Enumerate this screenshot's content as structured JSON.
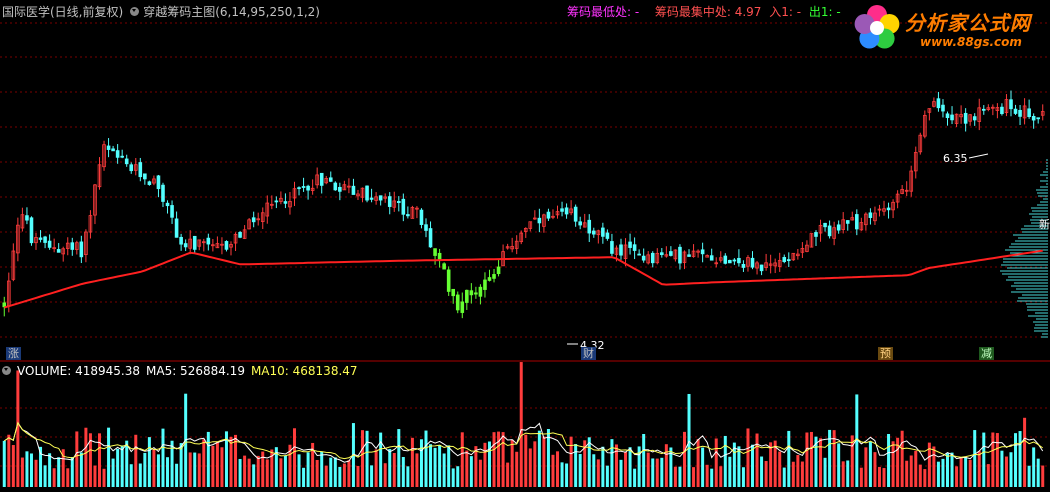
{
  "header": {
    "stock_name": "国际医学(日线,前复权)",
    "indicator_title": "穿越筹码主图(6,14,95,250,1,2)",
    "chip_low": "筹码最低处: -",
    "chip_center": "筹码最集中处: 4.97",
    "entry": "入1: -",
    "exit": "出1: -"
  },
  "volume_header": {
    "volume": "VOLUME: 418945.38",
    "ma5": "MA5: 526884.19",
    "ma10": "MA10: 468138.47"
  },
  "logo": {
    "name": "分析家公式网",
    "url": "www.88gs.com",
    "colors": [
      "#ff2d8a",
      "#ffd400",
      "#2ecc40",
      "#2d8cff",
      "#9b59b6"
    ]
  },
  "markers": {
    "high_label": "6.35",
    "low_label": "4.32",
    "chip_zhang": "涨",
    "chip_cai": "财",
    "chip_yu": "预",
    "chip_jian": "减",
    "chip_xin": "新"
  },
  "colors": {
    "up": "#ff3c3c",
    "down": "#54ffff",
    "green": "#66ff33",
    "ma_line": "#ff2020",
    "vol_ma5": "#ffffff",
    "vol_ma10": "#ffff55",
    "grid": "#7a0000",
    "chip_profile": "#54ffff",
    "header_pink": "#ff33ff",
    "header_red": "#ff5050",
    "header_green": "#33ff33"
  },
  "chart_data": {
    "type": "candlestick",
    "price_ylim": [
      4.1,
      6.9
    ],
    "volume_ylim": [
      0,
      1100000
    ],
    "ma_line_trend": [
      [
        0,
        4.52
      ],
      [
        40,
        4.72
      ],
      [
        70,
        4.82
      ],
      [
        95,
        4.98
      ],
      [
        120,
        4.88
      ],
      [
        200,
        4.91
      ],
      [
        310,
        4.94
      ],
      [
        335,
        4.71
      ],
      [
        360,
        4.73
      ],
      [
        460,
        4.79
      ],
      [
        470,
        4.85
      ],
      [
        530,
        5.0
      ]
    ],
    "chip_center_price": 4.97,
    "high_marker_price": 6.35,
    "low_marker_price": 4.32
  }
}
